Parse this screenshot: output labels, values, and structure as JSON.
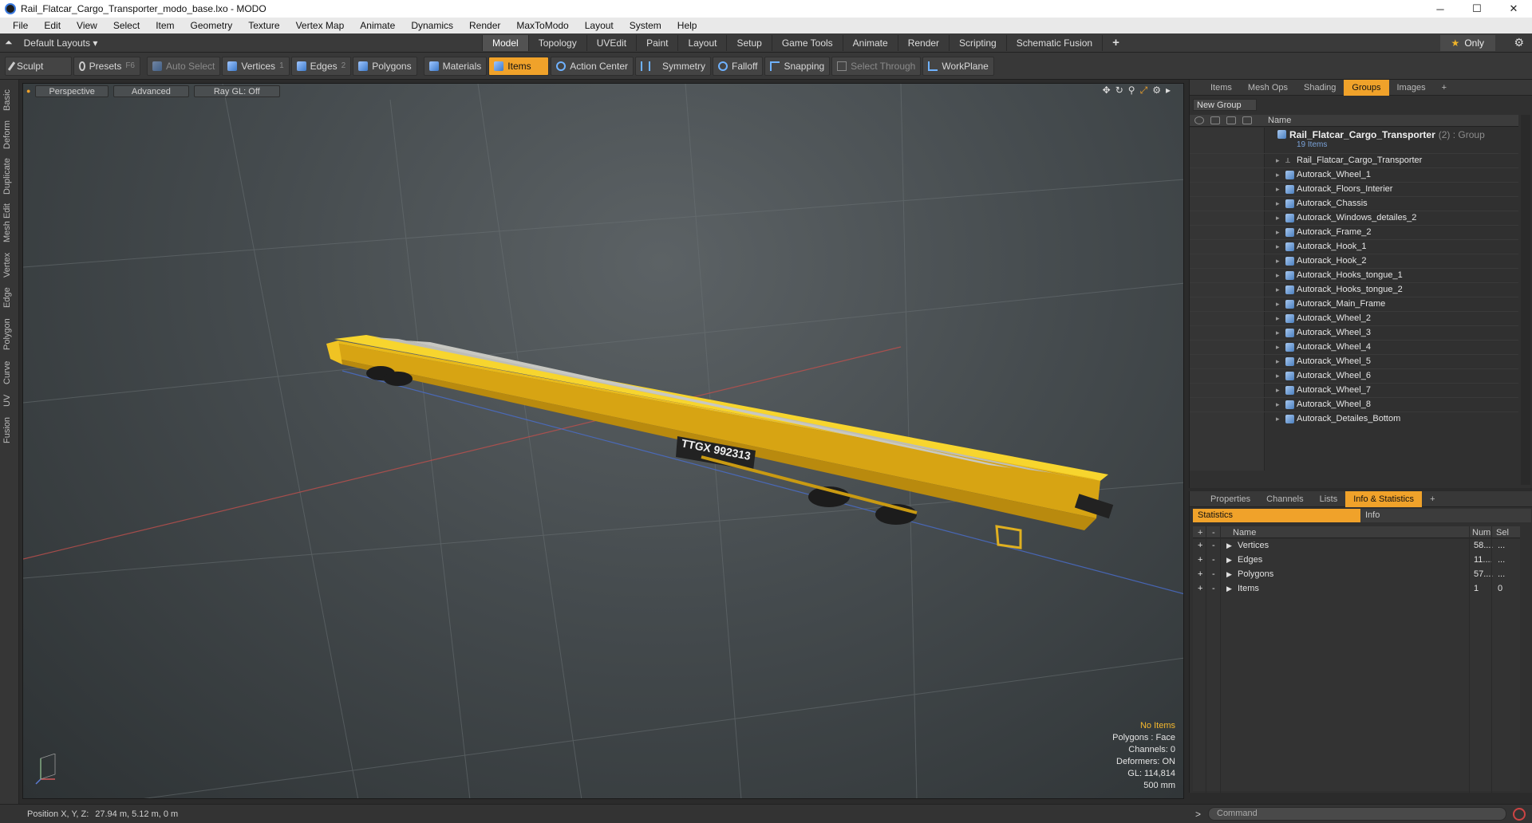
{
  "window": {
    "title": "Rail_Flatcar_Cargo_Transporter_modo_base.lxo - MODO",
    "min": "─",
    "max": "☐",
    "close": "✕"
  },
  "menu": [
    "File",
    "Edit",
    "View",
    "Select",
    "Item",
    "Geometry",
    "Texture",
    "Vertex Map",
    "Animate",
    "Dynamics",
    "Render",
    "MaxToModo",
    "Layout",
    "System",
    "Help"
  ],
  "layout": {
    "name": "Default Layouts ▾",
    "tabs": [
      "Model",
      "Topology",
      "UVEdit",
      "Paint",
      "Layout",
      "Setup",
      "Game Tools",
      "Animate",
      "Render",
      "Scripting",
      "Schematic Fusion"
    ],
    "active_tab": "Model",
    "plus": "+",
    "only": "Only"
  },
  "toolbar": {
    "sculpt": "Sculpt",
    "presets": "Presets",
    "presets_key": "F6",
    "auto_select": "Auto Select",
    "vertices": "Vertices",
    "vertices_key": "1",
    "edges": "Edges",
    "edges_key": "2",
    "polygons": "Polygons",
    "materials": "Materials",
    "items": "Items",
    "action_center": "Action Center",
    "symmetry": "Symmetry",
    "falloff": "Falloff",
    "snapping": "Snapping",
    "select_through": "Select Through",
    "workplane": "WorkPlane"
  },
  "sidebar": [
    "Basic",
    "Deform",
    "Duplicate",
    "Mesh Edit",
    "Vertex",
    "Edge",
    "Polygon",
    "Curve",
    "UV",
    "Fusion"
  ],
  "viewport": {
    "view": "Perspective",
    "mode": "Advanced",
    "raygl": "Ray GL: Off",
    "label_plate": "TTGX 992313",
    "info": {
      "items": "No Items",
      "polygons": "Polygons : Face",
      "channels": "Channels: 0",
      "deformers": "Deformers: ON",
      "gl": "GL: 114,814",
      "scale": "500 mm"
    }
  },
  "status": {
    "label": "Position X, Y, Z:",
    "value": "27.94 m, 5.12 m, 0 m"
  },
  "right_panel": {
    "tabs": [
      "Items",
      "Mesh Ops",
      "Shading",
      "Groups",
      "Images"
    ],
    "active": "Groups",
    "plus": "+",
    "new_group": "New Group",
    "col_name": "Name",
    "group_name": "Rail_Flatcar_Cargo_Transporter",
    "group_suffix": "(2) : Group",
    "group_count": "19 Items",
    "locator": "Rail_Flatcar_Cargo_Transporter",
    "items": [
      "Autorack_Wheel_1",
      "Autorack_Floors_Interier",
      "Autorack_Chassis",
      "Autorack_Windows_detailes_2",
      "Autorack_Frame_2",
      "Autorack_Hook_1",
      "Autorack_Hook_2",
      "Autorack_Hooks_tongue_1",
      "Autorack_Hooks_tongue_2",
      "Autorack_Main_Frame",
      "Autorack_Wheel_2",
      "Autorack_Wheel_3",
      "Autorack_Wheel_4",
      "Autorack_Wheel_5",
      "Autorack_Wheel_6",
      "Autorack_Wheel_7",
      "Autorack_Wheel_8",
      "Autorack_Detailes_Bottom"
    ]
  },
  "bottom_panel": {
    "tabs": [
      "Properties",
      "Channels",
      "Lists",
      "Info & Statistics"
    ],
    "active": "Info & Statistics",
    "plus": "+",
    "subtabs": [
      "Statistics",
      "Info"
    ],
    "head": {
      "plus": "+",
      "minus": "-",
      "name": "Name",
      "num": "Num",
      "sel": "Sel"
    },
    "rows": [
      {
        "name": "Vertices",
        "num": "58....",
        "sel": "..."
      },
      {
        "name": "Edges",
        "num": "11....",
        "sel": "..."
      },
      {
        "name": "Polygons",
        "num": "57....",
        "sel": "..."
      },
      {
        "name": "Items",
        "num": "1",
        "sel": "0"
      }
    ]
  },
  "command": {
    "prompt": ">",
    "placeholder": "Command"
  }
}
